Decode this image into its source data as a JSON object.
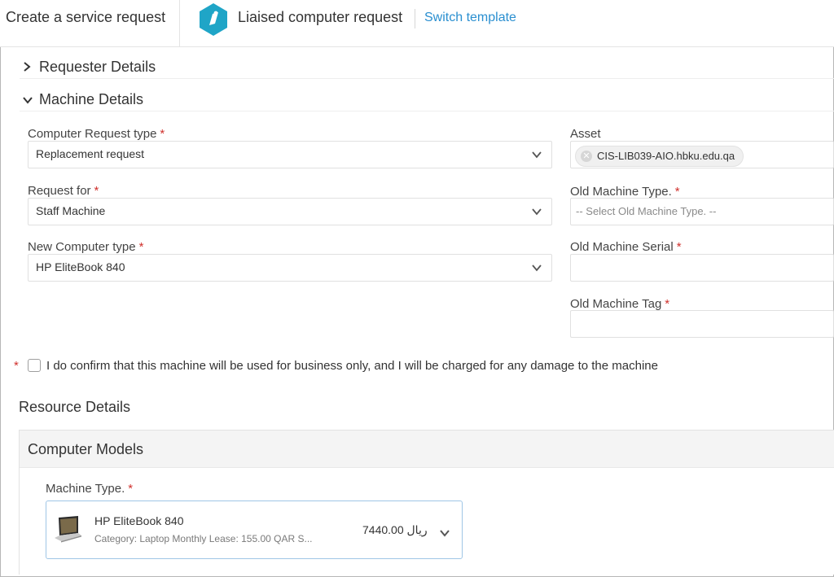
{
  "header": {
    "page_title": "Create a service request",
    "template_name": "Liaised computer request",
    "switch_label": "Switch template",
    "accent": "#1fa5c7",
    "link_color": "#2a8fd0"
  },
  "sections": {
    "requester": {
      "label": "Requester Details",
      "expanded": false
    },
    "machine": {
      "label": "Machine Details",
      "expanded": true
    }
  },
  "fields": {
    "computer_request_type": {
      "label": "Computer Request type",
      "value": "Replacement request",
      "required": "*"
    },
    "request_for": {
      "label": "Request for",
      "value": "Staff Machine",
      "required": "*"
    },
    "new_computer_type": {
      "label": "New Computer type",
      "value": "HP EliteBook 840",
      "required": "*"
    },
    "asset": {
      "label": "Asset",
      "chip": "CIS-LIB039-AIO.hbku.edu.qa"
    },
    "old_machine_type": {
      "label": "Old Machine Type.",
      "placeholder": "-- Select Old Machine Type. --",
      "required": "*"
    },
    "old_machine_serial": {
      "label": "Old Machine Serial",
      "value": "",
      "required": "*"
    },
    "old_machine_tag": {
      "label": "Old Machine Tag",
      "value": "",
      "required": "*"
    }
  },
  "consent": {
    "required": "*",
    "text": "I do confirm that this machine will be used for business only, and I will be charged for any damage to the machine",
    "checked": false
  },
  "resource": {
    "title": "Resource Details",
    "panel_title": "Computer Models",
    "machine_type": {
      "label": "Machine Type.",
      "required": "*",
      "name": "HP EliteBook 840",
      "category": "Category: Laptop Monthly Lease: 155.00 QAR S...",
      "price": "7440.00 ريال",
      "icon": "laptop-icon"
    }
  },
  "colors": {
    "required": "#d0312d",
    "selected_border": "#9fc6e6"
  }
}
